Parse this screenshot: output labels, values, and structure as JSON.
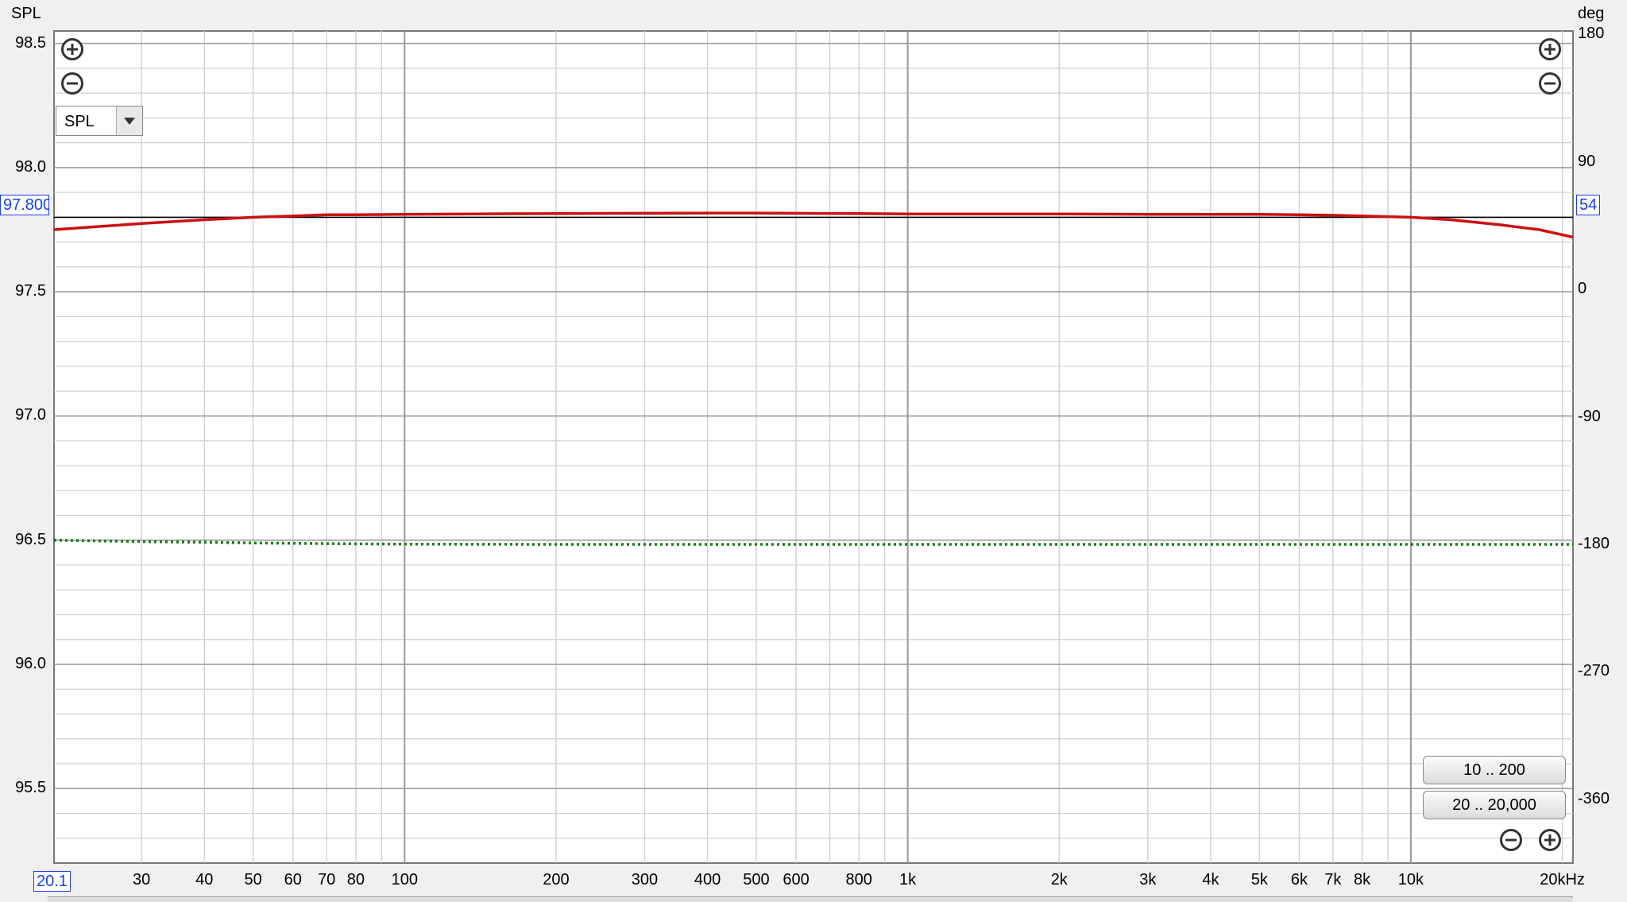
{
  "axes": {
    "left_title": "SPL",
    "right_title": "deg",
    "y_left_ticks": [
      {
        "value": 98.5,
        "label": "98.5"
      },
      {
        "value": 98.0,
        "label": "98.0"
      },
      {
        "value": 97.5,
        "label": "97.5"
      },
      {
        "value": 97.0,
        "label": "97.0"
      },
      {
        "value": 96.5,
        "label": "96.5"
      },
      {
        "value": 96.0,
        "label": "96.0"
      },
      {
        "value": 95.5,
        "label": "95.5"
      }
    ],
    "y_right_ticks": [
      {
        "value": 180,
        "label": "180"
      },
      {
        "value": 90,
        "label": "90"
      },
      {
        "value": 0,
        "label": "0"
      },
      {
        "value": -90,
        "label": "-90"
      },
      {
        "value": -180,
        "label": "-180"
      },
      {
        "value": -270,
        "label": "-270"
      },
      {
        "value": -360,
        "label": "-360"
      }
    ],
    "x_ticks": [
      {
        "value": 30,
        "label": "30"
      },
      {
        "value": 40,
        "label": "40"
      },
      {
        "value": 50,
        "label": "50"
      },
      {
        "value": 60,
        "label": "60"
      },
      {
        "value": 70,
        "label": "70"
      },
      {
        "value": 80,
        "label": "80"
      },
      {
        "value": 100,
        "label": "100"
      },
      {
        "value": 200,
        "label": "200"
      },
      {
        "value": 300,
        "label": "300"
      },
      {
        "value": 400,
        "label": "400"
      },
      {
        "value": 500,
        "label": "500"
      },
      {
        "value": 600,
        "label": "600"
      },
      {
        "value": 800,
        "label": "800"
      },
      {
        "value": 1000,
        "label": "1k"
      },
      {
        "value": 2000,
        "label": "2k"
      },
      {
        "value": 3000,
        "label": "3k"
      },
      {
        "value": 4000,
        "label": "4k"
      },
      {
        "value": 5000,
        "label": "5k"
      },
      {
        "value": 6000,
        "label": "6k"
      },
      {
        "value": 7000,
        "label": "7k"
      },
      {
        "value": 8000,
        "label": "8k"
      },
      {
        "value": 10000,
        "label": "10k"
      },
      {
        "value": 20000,
        "label": "20kHz"
      }
    ]
  },
  "cursor": {
    "spl_label": "97.800",
    "deg_label": "54",
    "freq_label": "20.1"
  },
  "selector": {
    "value": "SPL"
  },
  "buttons": {
    "range_1": "10 .. 200",
    "range_2": "20 .. 20,000"
  },
  "colors": {
    "spl_trace": "#cc1111",
    "phase_trace": "#1a7a1a",
    "grid_major": "#9a9a9a",
    "grid_minor": "#d0d0d0",
    "cursor_line": "#000000",
    "cursor_box": "#1a3cff"
  },
  "icons": [
    "zoom-in-icon",
    "zoom-out-icon",
    "chevron-down-icon"
  ],
  "chart_data": {
    "type": "line",
    "x_scale": "log",
    "xlim": [
      20.1,
      21000
    ],
    "ylim": [
      95.2,
      98.55
    ],
    "y2lim": [
      -405,
      182.5
    ],
    "grid": true,
    "series": [
      {
        "axis": "left",
        "style": "solid",
        "x": [
          20.1,
          30,
          40,
          50,
          60,
          70,
          80,
          100,
          200,
          300,
          400,
          500,
          600,
          800,
          1000,
          2000,
          3000,
          4000,
          5000,
          6000,
          7000,
          8000,
          10000,
          12000,
          15000,
          18000,
          21000
        ],
        "values": [
          97.75,
          97.775,
          97.79,
          97.8,
          97.805,
          97.81,
          97.81,
          97.812,
          97.815,
          97.816,
          97.817,
          97.817,
          97.816,
          97.815,
          97.813,
          97.813,
          97.812,
          97.812,
          97.812,
          97.81,
          97.808,
          97.805,
          97.8,
          97.79,
          97.77,
          97.75,
          97.72
        ]
      },
      {
        "axis": "right",
        "style": "dotted",
        "x": [
          20.1,
          30,
          40,
          50,
          70,
          100,
          200,
          500,
          1000,
          5000,
          10000,
          21000
        ],
        "values": [
          -177.0,
          -178.0,
          -178.5,
          -179.0,
          -179.5,
          -179.8,
          -180.0,
          -180.0,
          -180.0,
          -180.0,
          -180.0,
          -180.0
        ]
      }
    ]
  }
}
